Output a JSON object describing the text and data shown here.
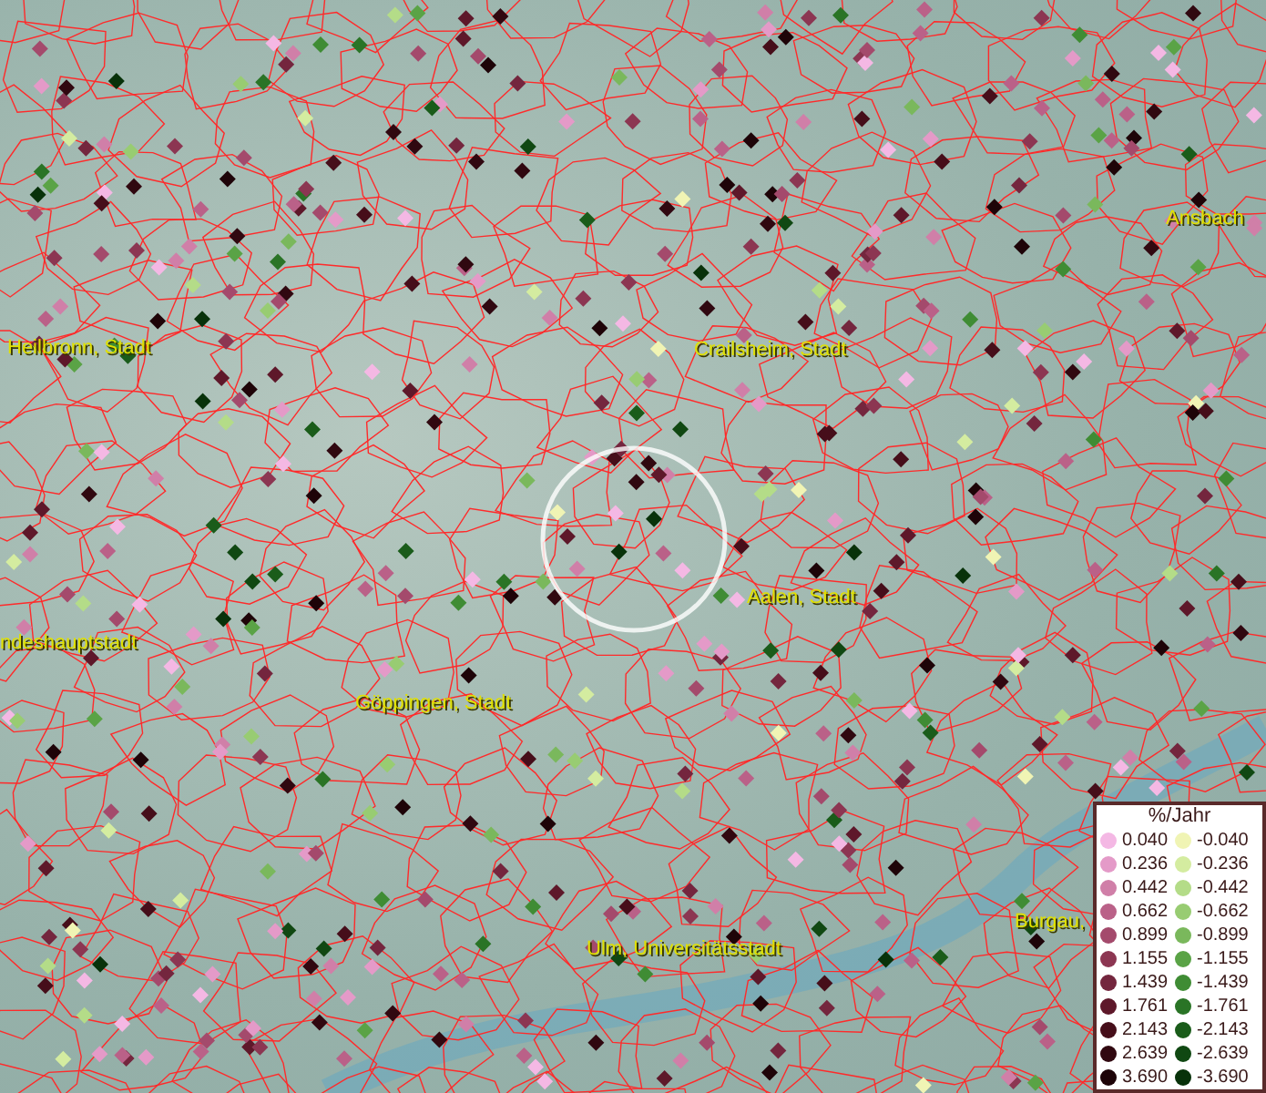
{
  "map": {
    "labels": [
      {
        "text": "Ansbach"
      },
      {
        "text": "Heilbronn, Stadt"
      },
      {
        "text": "Crailsheim, Stadt"
      },
      {
        "text": "Aalen, Stadt"
      },
      {
        "text": "ndeshauptstadt"
      },
      {
        "text": "Göppingen, Stadt"
      },
      {
        "text": "Burgau,"
      },
      {
        "text": "Ulm, Universitätsstadt"
      }
    ]
  },
  "legend": {
    "title": "%/Jahr",
    "rows": [
      {
        "positive": {
          "value": "0.040",
          "color": "#f4b8e4"
        },
        "negative": {
          "value": "-0.040",
          "color": "#f0f4b4"
        }
      },
      {
        "positive": {
          "value": "0.236",
          "color": "#e49ac8"
        },
        "negative": {
          "value": "-0.236",
          "color": "#d4eca0"
        }
      },
      {
        "positive": {
          "value": "0.442",
          "color": "#d07fa8"
        },
        "negative": {
          "value": "-0.442",
          "color": "#b4dc88"
        }
      },
      {
        "positive": {
          "value": "0.662",
          "color": "#ba6188"
        },
        "negative": {
          "value": "-0.662",
          "color": "#98cc72"
        }
      },
      {
        "positive": {
          "value": "0.899",
          "color": "#a44a6c"
        },
        "negative": {
          "value": "-0.899",
          "color": "#7ab85c"
        }
      },
      {
        "positive": {
          "value": "1.155",
          "color": "#8c3652"
        },
        "negative": {
          "value": "-1.155",
          "color": "#5aa346"
        }
      },
      {
        "positive": {
          "value": "1.439",
          "color": "#74263e"
        },
        "negative": {
          "value": "-1.439",
          "color": "#3f8c34"
        }
      },
      {
        "positive": {
          "value": "1.761",
          "color": "#5e182a"
        },
        "negative": {
          "value": "-1.761",
          "color": "#2a7426"
        }
      },
      {
        "positive": {
          "value": "2.143",
          "color": "#460e1a"
        },
        "negative": {
          "value": "-2.143",
          "color": "#1a5c1a"
        }
      },
      {
        "positive": {
          "value": "2.639",
          "color": "#300810"
        },
        "negative": {
          "value": "-2.639",
          "color": "#104812"
        }
      },
      {
        "positive": {
          "value": "3.690",
          "color": "#1e0408"
        },
        "negative": {
          "value": "-3.690",
          "color": "#08320a"
        }
      }
    ]
  }
}
